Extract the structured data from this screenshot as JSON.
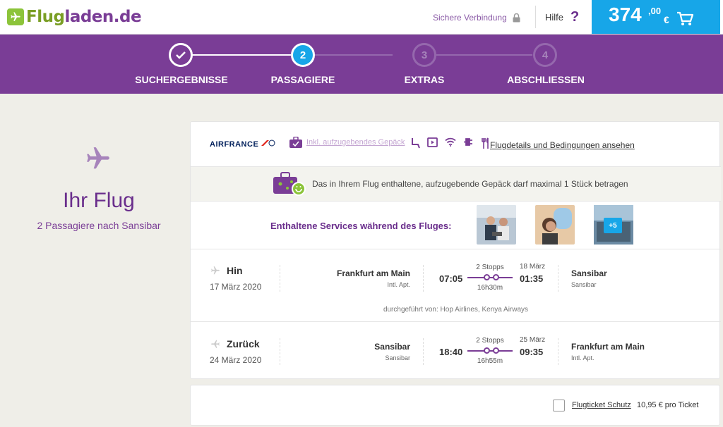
{
  "header": {
    "logo_part1": "Flug",
    "logo_part2": "laden",
    "logo_part3": ".de",
    "secure_label": "Sichere Verbindung",
    "help_label": "Hilfe",
    "help_symbol": "?",
    "cart_amount": "374",
    "cart_cents": ",00",
    "cart_currency": "€"
  },
  "steps": [
    {
      "number": "",
      "label": "SUCHERGEBNISSE",
      "state": "done"
    },
    {
      "number": "2",
      "label": "PASSAGIERE",
      "state": "active"
    },
    {
      "number": "3",
      "label": "EXTRAS",
      "state": "todo"
    },
    {
      "number": "4",
      "label": "ABSCHLIESSEN",
      "state": "todo"
    }
  ],
  "left": {
    "title": "Ihr Flug",
    "subtitle": "2 Passagiere nach Sansibar"
  },
  "card": {
    "airline_name": "AIRFRANCE",
    "baggage_text": "Inkl. aufzugebendes Gepäck",
    "details_link": "Flugdetails und Bedingungen ansehen",
    "luggage_note": "Das in Ihrem Flug enthaltene, aufzugebende Gepäck darf maximal 1 Stück betragen",
    "services_title": "Enthaltene Services während des Fluges:",
    "services_more": "+5",
    "outbound": {
      "direction": "Hin",
      "date": "17 März 2020",
      "from_city": "Frankfurt am Main",
      "from_airport": "Intl. Apt.",
      "dep_time": "07:05",
      "stops": "2 Stopps",
      "duration": "16h30m",
      "arr_date": "18 März",
      "arr_time": "01:35",
      "to_city": "Sansibar",
      "to_airport": "Sansibar",
      "operated_by": "durchgeführt von: Hop Airlines, Kenya Airways"
    },
    "return": {
      "direction": "Zurück",
      "date": "24 März 2020",
      "from_city": "Sansibar",
      "from_airport": "Sansibar",
      "dep_time": "18:40",
      "stops": "2 Stopps",
      "duration": "16h55m",
      "arr_date": "25 März",
      "arr_time": "09:35",
      "to_city": "Frankfurt am Main",
      "to_airport": "Intl. Apt."
    }
  },
  "ticket_protection": {
    "link": "Flugticket Schutz",
    "price": "10,95 € pro Ticket"
  },
  "colors": {
    "purple": "#7a3d96",
    "blue": "#17a6e8",
    "green": "#8cc43a"
  }
}
